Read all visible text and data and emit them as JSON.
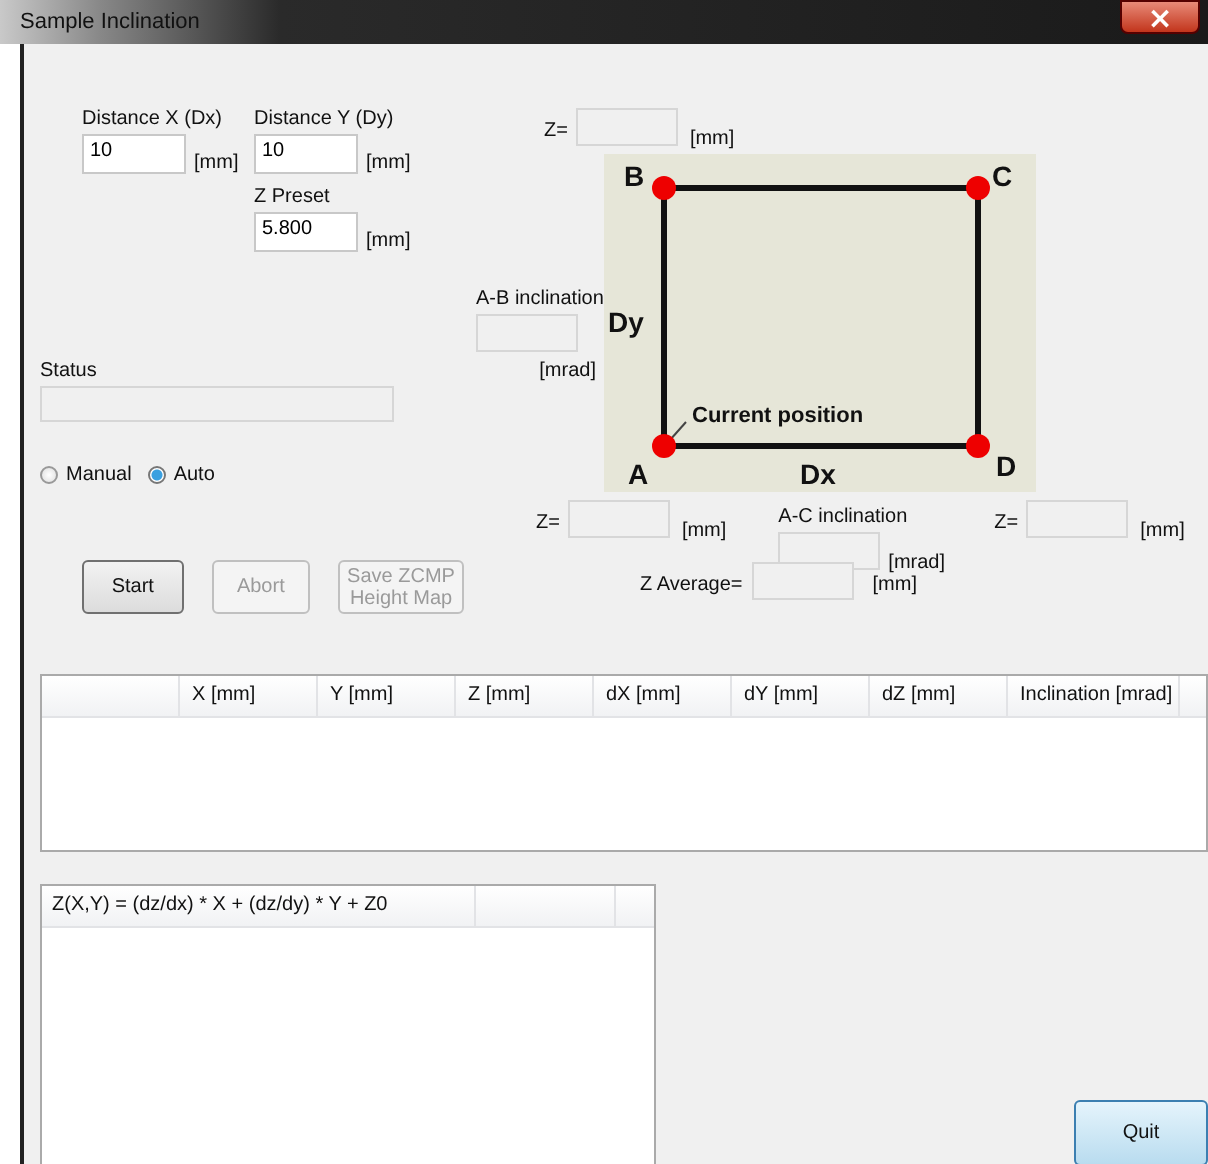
{
  "window": {
    "title": "Sample Inclination",
    "close": "×"
  },
  "distance_x": {
    "label": "Distance X (Dx)",
    "value": "10",
    "unit": "[mm]"
  },
  "distance_y": {
    "label": "Distance Y (Dy)",
    "value": "10",
    "unit": "[mm]"
  },
  "z_preset": {
    "label": "Z Preset",
    "value": "5.800",
    "unit": "[mm]"
  },
  "status": {
    "label": "Status"
  },
  "mode": [
    {
      "label": "Manual",
      "selected": false
    },
    {
      "label": "Auto",
      "selected": true
    }
  ],
  "buttons": [
    {
      "label": "Start",
      "disabled": false
    },
    {
      "label": "Abort",
      "disabled": true
    },
    {
      "label": "Save ZCMP\nHeight Map",
      "disabled": true
    }
  ],
  "z_b": {
    "label": "Z=",
    "unit": "[mm]"
  },
  "ab_inclination": {
    "label": "A-B inclination",
    "unit": "[mrad]"
  },
  "diagram": {
    "corners": [
      "B",
      "C",
      "A",
      "D"
    ],
    "dy": "Dy",
    "dx": "Dx",
    "current": "Current position"
  },
  "z_a": {
    "label": "Z=",
    "unit": "[mm]"
  },
  "ac_inclination": {
    "label": "A-C inclination",
    "unit": "[mrad]"
  },
  "z_d": {
    "label": "Z=",
    "unit": "[mm]"
  },
  "z_average": {
    "label": "Z Average=",
    "unit": "[mm]"
  },
  "table": {
    "columns": [
      "X [mm]",
      "Y [mm]",
      "Z [mm]",
      "dX [mm]",
      "dY [mm]",
      "dZ [mm]",
      "Inclination [mrad]"
    ]
  },
  "formula_list": {
    "columns": [
      "Z(X,Y) = (dz/dx) * X + (dz/dy) * Y + Z0"
    ]
  },
  "quit": {
    "label": "Quit"
  }
}
